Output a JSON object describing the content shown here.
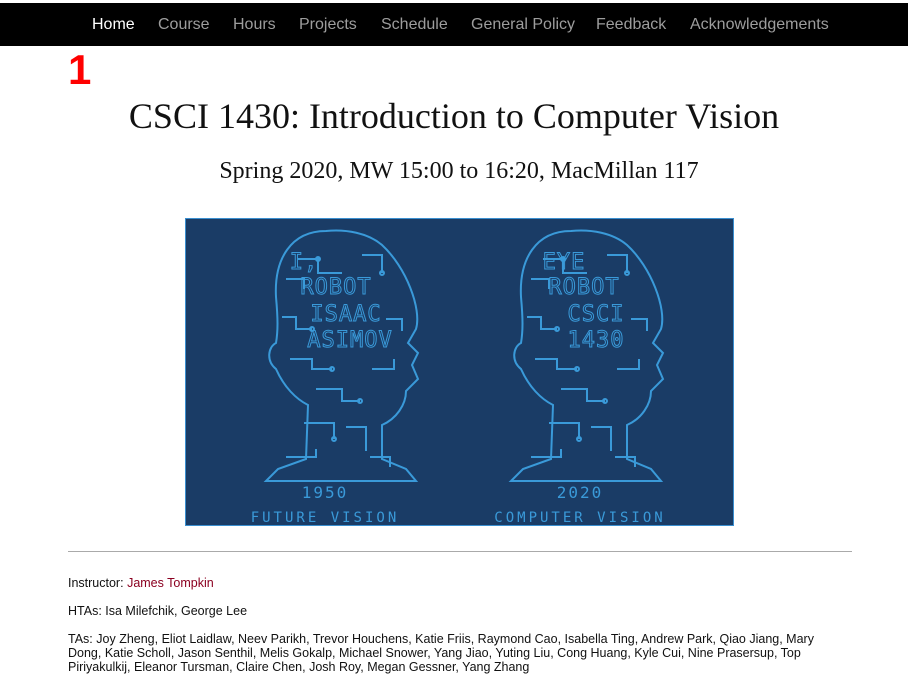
{
  "nav": {
    "items": [
      {
        "label": "Home",
        "active": true
      },
      {
        "label": "Course",
        "active": false
      },
      {
        "label": "Hours",
        "active": false
      },
      {
        "label": "Projects",
        "active": false
      },
      {
        "label": "Schedule",
        "active": false
      },
      {
        "label": "General Policy",
        "active": false
      },
      {
        "label": "Feedback",
        "active": false
      },
      {
        "label": "Acknowledgements",
        "active": false
      }
    ]
  },
  "annotation_marker": "1",
  "page": {
    "title": "CSCI 1430: Introduction to Computer Vision",
    "subtitle": "Spring 2020, MW 15:00 to 16:20, MacMillan 117"
  },
  "banner": {
    "left_head_lines": [
      "I,",
      "ROBOT",
      "ISAAC",
      "ASIMOV"
    ],
    "right_head_lines": [
      "EYE",
      "ROBOT",
      "CSCI",
      "1430"
    ],
    "left_year": "1950",
    "right_year": "2020",
    "left_caption": "FUTURE VISION",
    "right_caption": "COMPUTER VISION",
    "colors": {
      "background": "#1a3c66",
      "lines": "#3a9ad9"
    }
  },
  "staff": {
    "instructor_label": "Instructor:",
    "instructor_name": "James Tompkin",
    "htas_label": "HTAs:",
    "htas": "Isa Milefchik, George Lee",
    "tas_label": "TAs:",
    "tas": "Joy Zheng, Eliot Laidlaw, Neev Parikh, Trevor Houchens, Katie Friis, Raymond Cao, Isabella Ting, Andrew Park, Qiao Jiang, Mary Dong, Katie Scholl, Jason Senthil, Melis Gokalp, Michael Snower, Yang Jiao, Yuting Liu, Cong Huang, Kyle Cui, Nine Prasersup, Top Piriyakulkij, Eleanor Tursman, Claire Chen, Josh Roy, Megan Gessner, Yang Zhang"
  }
}
